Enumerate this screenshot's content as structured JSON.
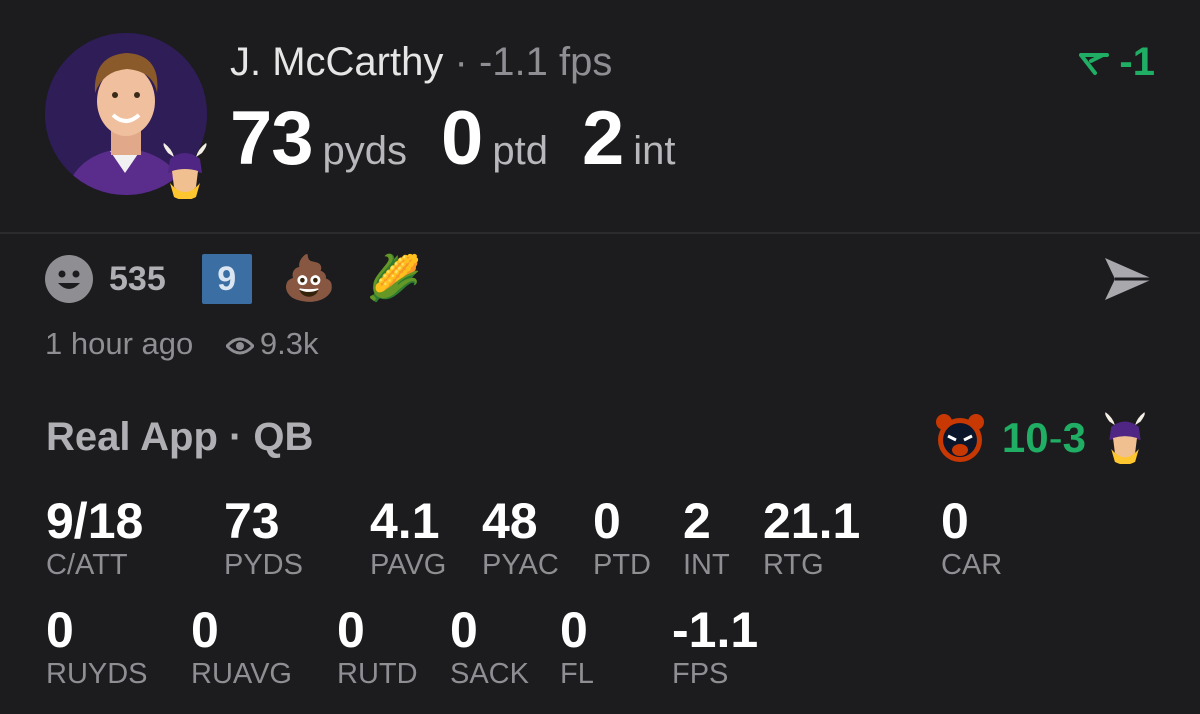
{
  "player": {
    "name": "J. McCarthy",
    "separator": "·",
    "fps": "-1.1 fps"
  },
  "headline_stats": [
    {
      "value": "73",
      "unit": "pyds"
    },
    {
      "value": "0",
      "unit": "ptd"
    },
    {
      "value": "2",
      "unit": "int"
    }
  ],
  "change": {
    "value": "-1",
    "color": "#1fae63",
    "icon": "trend-down-arrow-icon"
  },
  "reactions": {
    "smiley_count": "535",
    "badge": "9",
    "emoji_1": "💩",
    "emoji_2": "🌽"
  },
  "meta": {
    "time": "1 hour ago",
    "views": "9.3k"
  },
  "game": {
    "title": "Real App · QB",
    "away_score": "10",
    "dash": "-",
    "home_score": "3",
    "away_team_icon": "bears-logo-icon",
    "home_team_icon": "vikings-logo-icon"
  },
  "stats_row1": [
    {
      "value": "9/18",
      "label": "C/ATT"
    },
    {
      "value": "73",
      "label": "PYDS"
    },
    {
      "value": "4.1",
      "label": "PAVG"
    },
    {
      "value": "48",
      "label": "PYAC"
    },
    {
      "value": "0",
      "label": "PTD"
    },
    {
      "value": "2",
      "label": "INT"
    },
    {
      "value": "21.1",
      "label": "RTG"
    },
    {
      "value": "0",
      "label": "CAR"
    }
  ],
  "stats_row2": [
    {
      "value": "0",
      "label": "RUYDS"
    },
    {
      "value": "0",
      "label": "RUAVG"
    },
    {
      "value": "0",
      "label": "RUTD"
    },
    {
      "value": "0",
      "label": "SACK"
    },
    {
      "value": "0",
      "label": "FL"
    },
    {
      "value": "-1.1",
      "label": "FPS"
    }
  ]
}
